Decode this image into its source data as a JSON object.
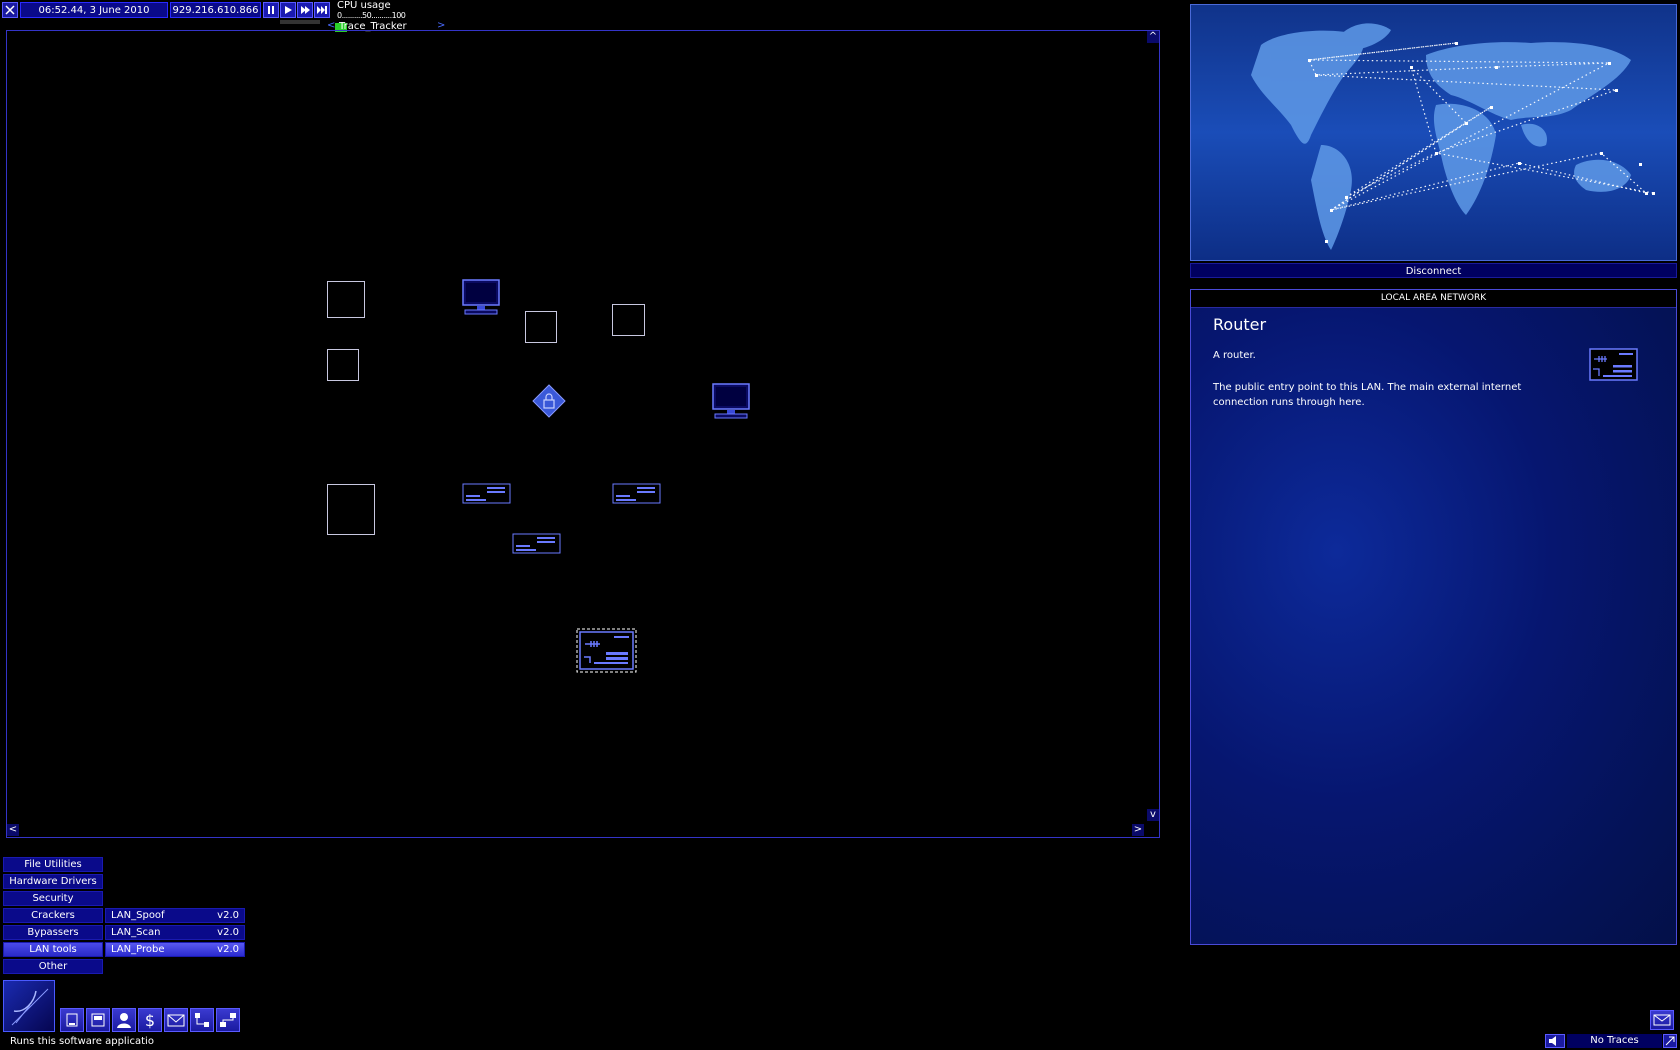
{
  "hud": {
    "datetime": "06:52.44, 3 June 2010",
    "ip": "929.216.610.866",
    "cpu_label": "CPU usage",
    "cpu_scale": "0..........50..........100",
    "tracker_label": "Trace_Tracker",
    "tracker_prev": "<",
    "tracker_next": ">"
  },
  "lan_view": {
    "scroll_up": "^",
    "scroll_down": "v",
    "scroll_left": "<",
    "scroll_right": ">"
  },
  "world_map": {
    "disconnect_label": "Disconnect"
  },
  "info_panel": {
    "header": "LOCAL AREA NETWORK",
    "title": "Router",
    "subtitle": "A router.",
    "description": "The public entry point to this LAN. The main external internet connection runs through here."
  },
  "software_menu": {
    "categories": [
      {
        "label": "File Utilities"
      },
      {
        "label": "Hardware Drivers"
      },
      {
        "label": "Security"
      },
      {
        "label": "Crackers"
      },
      {
        "label": "Bypassers"
      },
      {
        "label": "LAN tools"
      },
      {
        "label": "Other"
      }
    ],
    "lan_tools": [
      {
        "name": "LAN_Spoof",
        "version": "v2.0"
      },
      {
        "name": "LAN_Scan",
        "version": "v2.0"
      },
      {
        "name": "LAN_Probe",
        "version": "v2.0"
      }
    ]
  },
  "status": {
    "tooltip": "Runs this software applicatio",
    "traces": "No Traces"
  },
  "icons": [
    "close-icon",
    "pause-icon",
    "play-icon",
    "fast-forward-icon",
    "skip-forward-icon",
    "software-icon",
    "hardware-icon",
    "memory-icon",
    "person-icon",
    "dollar-icon",
    "email-icon",
    "network-icon",
    "lan-icon",
    "lock-icon",
    "mail-icon",
    "speaker-icon"
  ]
}
